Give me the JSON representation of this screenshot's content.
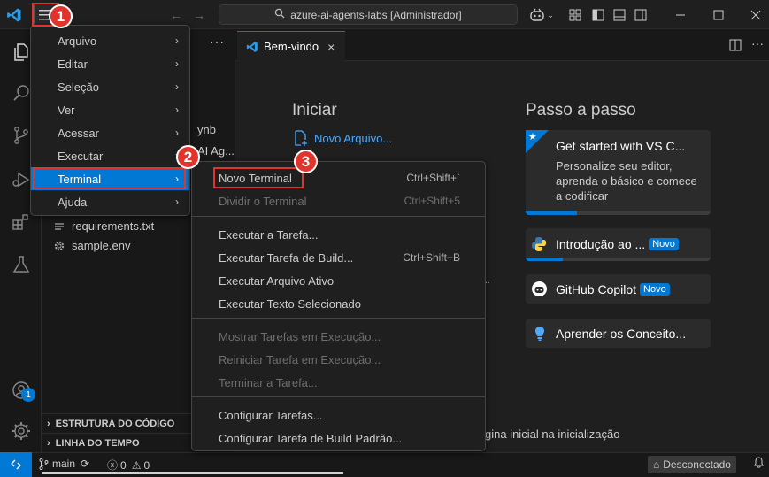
{
  "titlebar": {
    "search_text": "azure-ai-agents-labs [Administrador]"
  },
  "sidebar": {
    "partial_items": [
      "ynb",
      "AI Ag..."
    ],
    "files": [
      {
        "name": "requirements.txt",
        "icon": "lines-icon"
      },
      {
        "name": "sample.env",
        "icon": "gear-icon"
      }
    ],
    "sections": [
      "ESTRUTURA DO CÓDIGO",
      "LINHA DO TEMPO"
    ]
  },
  "editor": {
    "tab_label": "Bem-vindo",
    "start_heading": "Iniciar",
    "new_file_link": "Novo Arquivo...",
    "walkthrough_heading": "Passo a passo",
    "cards": [
      {
        "title": "Get started with VS C...",
        "desc": "Personalize seu editor, aprenda o básico e comece a codificar"
      },
      {
        "title": "Introdução ao ...",
        "badge": "Novo"
      },
      {
        "title": "GitHub Copilot",
        "badge": "Novo"
      },
      {
        "title": "Aprender os Conceito..."
      }
    ],
    "startup_text": "gina inicial na inicialização"
  },
  "main_menu": {
    "items": [
      "Arquivo",
      "Editar",
      "Seleção",
      "Ver",
      "Acessar",
      "Executar",
      "Terminal",
      "Ajuda"
    ],
    "selected": "Terminal"
  },
  "terminal_menu": {
    "groups": [
      [
        {
          "label": "Novo Terminal",
          "shortcut": "Ctrl+Shift+`",
          "enabled": true
        },
        {
          "label": "Dividir o Terminal",
          "shortcut": "Ctrl+Shift+5",
          "enabled": false
        }
      ],
      [
        {
          "label": "Executar a Tarefa...",
          "shortcut": "",
          "enabled": true
        },
        {
          "label": "Executar Tarefa de Build...",
          "shortcut": "Ctrl+Shift+B",
          "enabled": true
        },
        {
          "label": "Executar Arquivo Ativo",
          "shortcut": "",
          "enabled": true
        },
        {
          "label": "Executar Texto Selecionado",
          "shortcut": "",
          "enabled": true
        }
      ],
      [
        {
          "label": "Mostrar Tarefas em Execução...",
          "shortcut": "",
          "enabled": false
        },
        {
          "label": "Reiniciar Tarefa em Execução...",
          "shortcut": "",
          "enabled": false
        },
        {
          "label": "Terminar a Tarefa...",
          "shortcut": "",
          "enabled": false
        }
      ],
      [
        {
          "label": "Configurar Tarefas...",
          "shortcut": "",
          "enabled": true
        },
        {
          "label": "Configurar Tarefa de Build Padrão...",
          "shortcut": "",
          "enabled": true
        }
      ]
    ]
  },
  "statusbar": {
    "branch": "main",
    "problems": "0",
    "warnings": "0",
    "connection": "Desconectado"
  },
  "accounts_badge": "1",
  "steps": [
    "1",
    "2",
    "3"
  ],
  "colors": {
    "accent": "#0078d4",
    "highlight": "#e0342c"
  }
}
